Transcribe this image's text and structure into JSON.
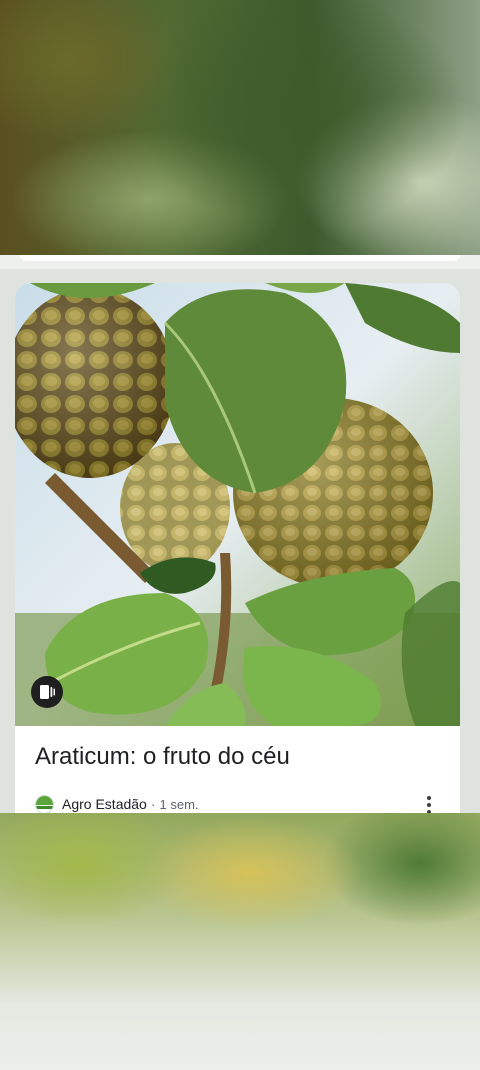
{
  "card": {
    "title": "Araticum: o fruto do céu",
    "source": "Agro Estadão",
    "separator": "·",
    "time": "1 sem.",
    "image_icon": "fruit-photo",
    "badge_icon": "web-story-icon",
    "more_icon": "more-vert-icon"
  },
  "colors": {
    "title_text": "#202124",
    "meta_text": "#5f6368",
    "card_bg": "#ffffff",
    "page_bg": "#dfe3de"
  }
}
